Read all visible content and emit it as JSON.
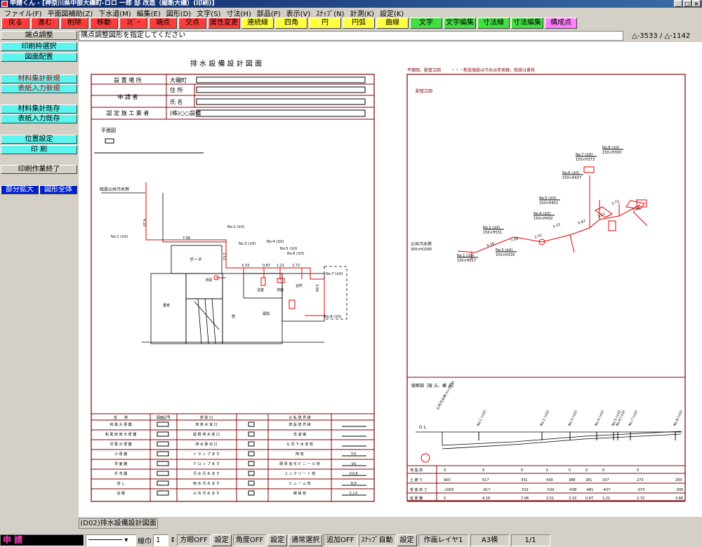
{
  "window": {
    "title": "申請くん - [神奈川県中部大磯町-ロロ 一郎 邸 改造（縦断大磯）(印刷)]"
  },
  "menu": [
    "ファイル(F)",
    "平面図補助(Z)",
    "下水道(M)",
    "編集(E)",
    "図形(D)",
    "文字(S)",
    "寸法(H)",
    "部品(P)",
    "表示(V)",
    "ｽﾅｯﾌﾟ(N)",
    "計測(K)",
    "設定(K)"
  ],
  "toolbar": [
    {
      "label": "戻る",
      "color": "#ff3c3c"
    },
    {
      "label": "進む",
      "color": "#ff3c3c"
    },
    {
      "label": "削除",
      "color": "#ff3c3c"
    },
    {
      "label": "移動",
      "color": "#ff3c3c"
    },
    {
      "label": "ｺﾋﾟｰ",
      "color": "#ff3c3c"
    },
    {
      "label": "端点",
      "color": "#ff3c3c"
    },
    {
      "label": "交点",
      "color": "#ff3c3c"
    },
    {
      "label": "属性変更",
      "color": "#ff3c3c"
    },
    {
      "label": "連続線",
      "color": "#ffff40"
    },
    {
      "label": "四角",
      "color": "#ffff40"
    },
    {
      "label": "円",
      "color": "#ffff40"
    },
    {
      "label": "円弧",
      "color": "#ffff40"
    },
    {
      "label": "曲線",
      "color": "#ffff40"
    },
    {
      "label": "文字",
      "color": "#40e040"
    },
    {
      "label": "文字編集",
      "color": "#40e040"
    },
    {
      "label": "寸法線",
      "color": "#40e040"
    },
    {
      "label": "寸法編集",
      "color": "#40e040"
    },
    {
      "label": "構成点",
      "color": "#ff80ff"
    }
  ],
  "left_panel": {
    "header": "端点調整",
    "items": [
      "印刷枠選択",
      "図面配置",
      "材料集計新規",
      "表紙入力新規",
      "材料集計既存",
      "表紙入力既存",
      "位置設定",
      "印 刷",
      "印刷作業終了"
    ],
    "zoom_part": "部分拡大",
    "zoom_all": "図形全体"
  },
  "prompt": "隅点調整図形を指定してください",
  "coords": "△-3533 / △-1142",
  "drawing": {
    "title": "排 水 設 備 設 計 図 面",
    "form": {
      "location_label": "設 置 場 所",
      "location_value": "大磯町",
      "applicant_label": "申 請 者",
      "address_label": "住 所",
      "name_label": "氏 名",
      "contractor_label": "認 定 施 工 業 者",
      "contractor_value": "(株)○○設備"
    },
    "plan_label": "平面図",
    "right_header": "平面図、配管立図",
    "right_note": "・・・新設施設は汚水は赤実線、既設は黄色",
    "iso_label": "配管立図",
    "profile_label": "縦断図［縦 占、横 占］",
    "public_sewer": "既設公共汚水桝",
    "public_sewer_iso": "公共汚水桝",
    "public_sewer_size": "300×H1000",
    "plan_rooms": {
      "porch": "ポーチ",
      "wc": "洋間",
      "room1": "書斎",
      "room2": "居",
      "room3": "寝間",
      "bath1": "浴室",
      "bath2": "洗面",
      "kitchen": "台所"
    },
    "plan_nodes": [
      "No.1 (±0)",
      "No.2 (±0)",
      "No.3 (±0)",
      "No.4 (±0)",
      "No.5 (±0)",
      "No.6 (±0)",
      "No.7 (±0)",
      "No.8 (±0)"
    ],
    "plan_dims": [
      "4.10",
      "7.06",
      "3.33",
      "2.51",
      "0.87",
      "1.21",
      "2.72",
      "3.66",
      "2.08"
    ],
    "iso_nodes": [
      {
        "name": "No.1 (±0)",
        "size": "150×H517"
      },
      {
        "name": "No.2 (±0)",
        "size": "150×H531"
      },
      {
        "name": "No.3 (±0)",
        "size": "150×H339"
      },
      {
        "name": "No.4 (±0)",
        "size": "150×H439"
      },
      {
        "name": "No.5 (±0)",
        "size": "150×H451"
      },
      {
        "name": "No.6 (±0)",
        "size": "150×H437"
      },
      {
        "name": "No.7 (±0)",
        "size": "150×H373"
      },
      {
        "name": "No.8 (±0)",
        "size": "150×H300"
      }
    ],
    "iso_dims": [
      "4.16",
      "7.06",
      "2.51",
      "3.33",
      "0.87",
      "1.21",
      "2.72",
      "3.66"
    ],
    "profile": {
      "gl": "G L",
      "sewer_text": "公共汚水桝 h=1000",
      "nodes": [
        "No.1 (±0)",
        "No.2 (±0)",
        "No.3 (±0)",
        "No.4 (±0)",
        "No.5 (±0)",
        "No.6 (±0)",
        "No.7 (±0)",
        "No.8 (±0)"
      ],
      "row_labels": [
        "地 盤 高",
        "土 被 り",
        "管 底 高 さ",
        "延 距 離"
      ],
      "row1": [
        "0",
        "0",
        "0",
        "0",
        "0",
        "0",
        "0",
        "0",
        "0"
      ],
      "row2": [
        "900",
        "517",
        "",
        "331",
        "439",
        "388",
        "381",
        "337",
        "273",
        "200"
      ],
      "row3": [
        "-1000",
        "-917",
        "",
        "-531",
        "-539",
        "-438",
        "-481",
        "-437",
        "-373",
        "-300"
      ],
      "row4": [
        "0",
        "4.16",
        "",
        "7.06",
        "2.51",
        "3.33",
        "0.87",
        "1.21",
        "2.72",
        "3.66"
      ]
    },
    "legend": {
      "col1_head": "名　　称",
      "col2_head": "図面記号",
      "col3_head": "排 除 口",
      "col5_head": "公 私 境 界 線",
      "rows": [
        [
          "和 風 大 便 器",
          "床 排 水 受 口",
          "既 設 境 界 線"
        ],
        [
          "和 風 両 用 大 便 器",
          "屋 根 排 水 受 口",
          "洗 濯 機"
        ],
        [
          "洋 風 大 便 器",
          "排 水 取 出 口",
          "公 共 下 水 道 管"
        ],
        [
          "小 便 器",
          "ト ラ ッ プ ま す",
          "陶 管"
        ],
        [
          "洗 面 器",
          "ド ロ ッ プ ま す",
          "硬 質 塩 化 ビ ニ ー ル 管"
        ],
        [
          "手 洗 器",
          "汚 水 汚 水 ま す",
          "コ ン ク リ ー ト 管"
        ],
        [
          "流 し",
          "雨 水 汚 水 ま す",
          "ヒ ュ ー ム 管"
        ],
        [
          "浴 槽",
          "公 共 汚 水 ま す",
          "鋳 鉄 管"
        ]
      ],
      "codes": [
        "",
        "",
        "",
        "",
        "T.P.",
        "VU",
        "CO.P.",
        "H.P.",
        "C.I.P."
      ]
    }
  },
  "sheet_tab": "(D02)排水設備設計図面",
  "status": {
    "brand": "申 請",
    "line_width_label": "線巾",
    "line_width_value": "1",
    "grid": "方眼OFF",
    "set1": "設定",
    "angle": "角度OFF",
    "set2": "設定",
    "select": "通常選択",
    "add": "追加OFF",
    "snap": "ｽﾅｯﾌﾟ自動",
    "set3": "設定",
    "layer": "作画レイヤ1",
    "paper": "A3横",
    "page": "1/1"
  },
  "colors": {
    "frame": "#800000",
    "pipe": "#e00000",
    "cyan": "#5ff5ef",
    "blue": "#0020d0"
  }
}
